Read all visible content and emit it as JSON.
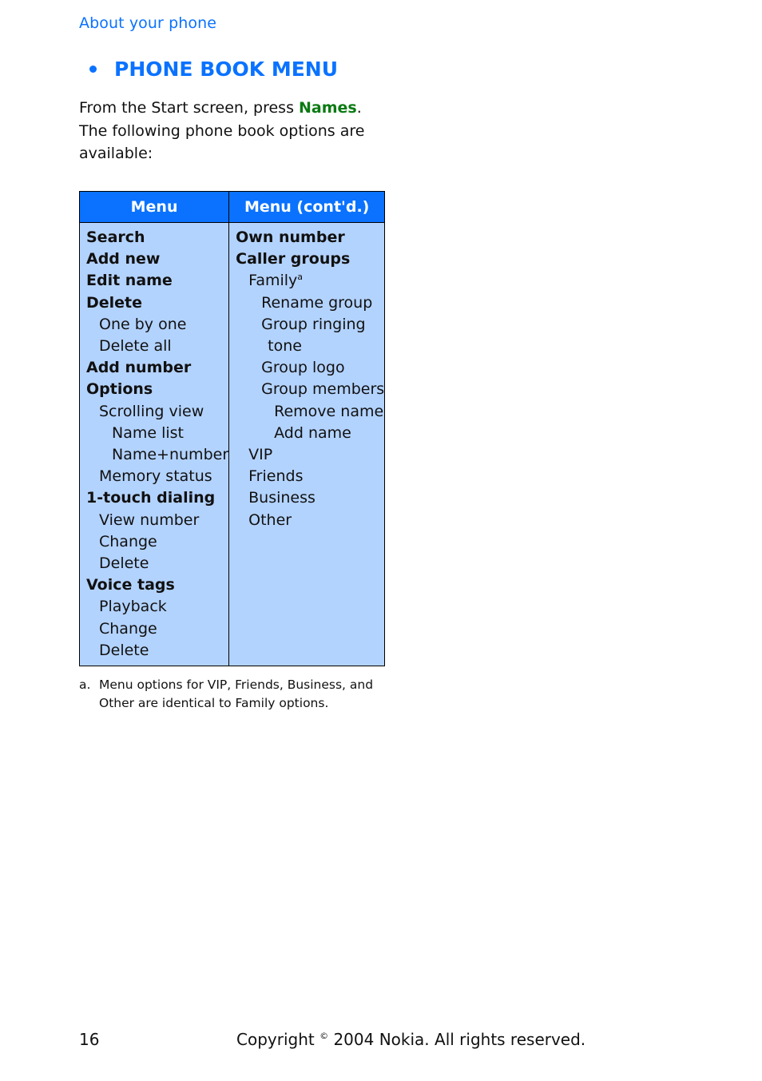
{
  "header": {
    "running_title": "About your phone"
  },
  "section": {
    "title": "PHONE BOOK MENU",
    "bullet_icon": "bullet-dot"
  },
  "intro": {
    "before": "From the Start screen, press ",
    "keyword": "Names",
    "after": ". The following phone book options are available:"
  },
  "table": {
    "headers": [
      "Menu",
      "Menu (cont'd.)"
    ],
    "col1": [
      {
        "label": "Search",
        "level": 0
      },
      {
        "label": "Add new",
        "level": 0
      },
      {
        "label": "Edit name",
        "level": 0
      },
      {
        "label": "Delete",
        "level": 0
      },
      {
        "label": "One by one",
        "level": 1
      },
      {
        "label": "Delete all",
        "level": 1
      },
      {
        "label": "Add number",
        "level": 0
      },
      {
        "label": "Options",
        "level": 0
      },
      {
        "label": "Scrolling view",
        "level": 1
      },
      {
        "label": "Name list",
        "level": 2
      },
      {
        "label": "Name+number",
        "level": 2
      },
      {
        "label": "Memory status",
        "level": 1
      },
      {
        "label": "1-touch dialing",
        "level": 0
      },
      {
        "label": "View number",
        "level": 1
      },
      {
        "label": "Change",
        "level": 1
      },
      {
        "label": "Delete",
        "level": 1
      },
      {
        "label": "Voice tags",
        "level": 0
      },
      {
        "label": "Playback",
        "level": 1
      },
      {
        "label": "Change",
        "level": 1
      },
      {
        "label": "Delete",
        "level": 1
      }
    ],
    "col2": [
      {
        "label": "Own number",
        "level": 0
      },
      {
        "label": "Caller groups",
        "level": 0
      },
      {
        "label": "Family",
        "level": 1,
        "footnote_ref": "a"
      },
      {
        "label": "Rename group",
        "level": 2
      },
      {
        "label": "Group ringing",
        "level": 2
      },
      {
        "label": "tone",
        "level": "cont"
      },
      {
        "label": "Group logo",
        "level": 2
      },
      {
        "label": "Group members",
        "level": 2
      },
      {
        "label": "Remove name",
        "level": 3
      },
      {
        "label": "Add name",
        "level": 3
      },
      {
        "label": "VIP",
        "level": 1
      },
      {
        "label": "Friends",
        "level": 1
      },
      {
        "label": "Business",
        "level": 1
      },
      {
        "label": "Other",
        "level": 1
      }
    ]
  },
  "footnote": {
    "mark": "a.",
    "text": "Menu options for VIP, Friends, Business, and Other are identical to Family options."
  },
  "footer": {
    "page_number": "16",
    "copyright_before": "Copyright ",
    "copyright_symbol": "©",
    "copyright_after": " 2004 Nokia. All rights reserved."
  },
  "colors": {
    "accent_blue": "#0a72ff",
    "keyword_green": "#0a7a12",
    "cell_background": "#b3d3ff"
  }
}
